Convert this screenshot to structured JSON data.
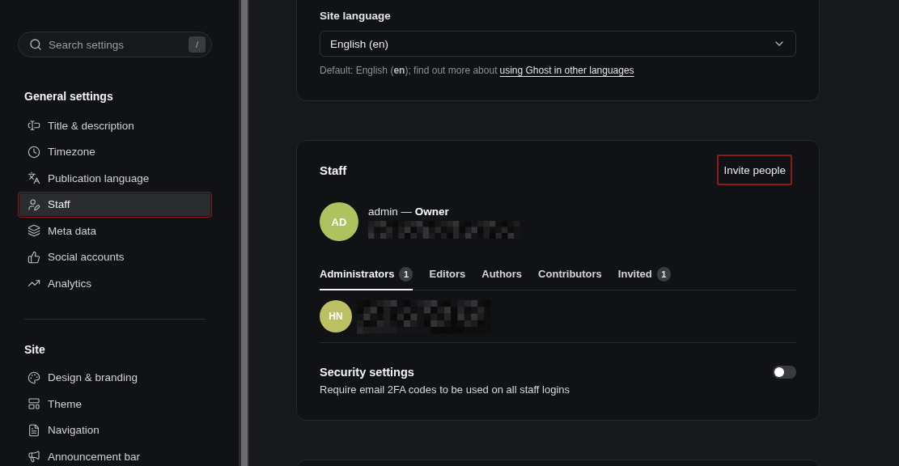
{
  "sidebar": {
    "search": {
      "placeholder": "Search settings",
      "shortcut": "/"
    },
    "sections": [
      {
        "title": "General settings",
        "items": [
          {
            "label": "Title & description",
            "selected": false,
            "highlighted": false
          },
          {
            "label": "Timezone",
            "selected": false,
            "highlighted": false
          },
          {
            "label": "Publication language",
            "selected": false,
            "highlighted": false
          },
          {
            "label": "Staff",
            "selected": true,
            "highlighted": true
          },
          {
            "label": "Meta data",
            "selected": false,
            "highlighted": false
          },
          {
            "label": "Social accounts",
            "selected": false,
            "highlighted": false
          },
          {
            "label": "Analytics",
            "selected": false,
            "highlighted": false
          }
        ]
      },
      {
        "title": "Site",
        "items": [
          {
            "label": "Design & branding",
            "selected": false,
            "highlighted": false
          },
          {
            "label": "Theme",
            "selected": false,
            "highlighted": false
          },
          {
            "label": "Navigation",
            "selected": false,
            "highlighted": false
          },
          {
            "label": "Announcement bar",
            "selected": false,
            "highlighted": false
          }
        ]
      }
    ]
  },
  "language_card": {
    "label": "Site language",
    "select": {
      "value": "English (en)"
    },
    "hint": "Default: English (**en**); find out more about",
    "link": "using Ghost in other languages"
  },
  "staff_card": {
    "title": "Staff",
    "invite_button": {
      "label": "Invite people",
      "highlighted": true
    },
    "owner": {
      "initials": "AD",
      "name": "admin — **Owner**",
      "color": "#acc35e"
    },
    "tabs": [
      {
        "label": "Administrators",
        "count": "1",
        "selected": true
      },
      {
        "label": "Editors",
        "selected": false
      },
      {
        "label": "Authors",
        "selected": false
      },
      {
        "label": "Contributors",
        "selected": false
      },
      {
        "label": "Invited",
        "count": "1",
        "selected": false
      }
    ],
    "members": [
      {
        "initials": "HN",
        "color": "#bcc063"
      }
    ],
    "security": {
      "title": "Security settings",
      "description": "Require email 2FA codes to be used on all staff logins",
      "on": false
    }
  }
}
